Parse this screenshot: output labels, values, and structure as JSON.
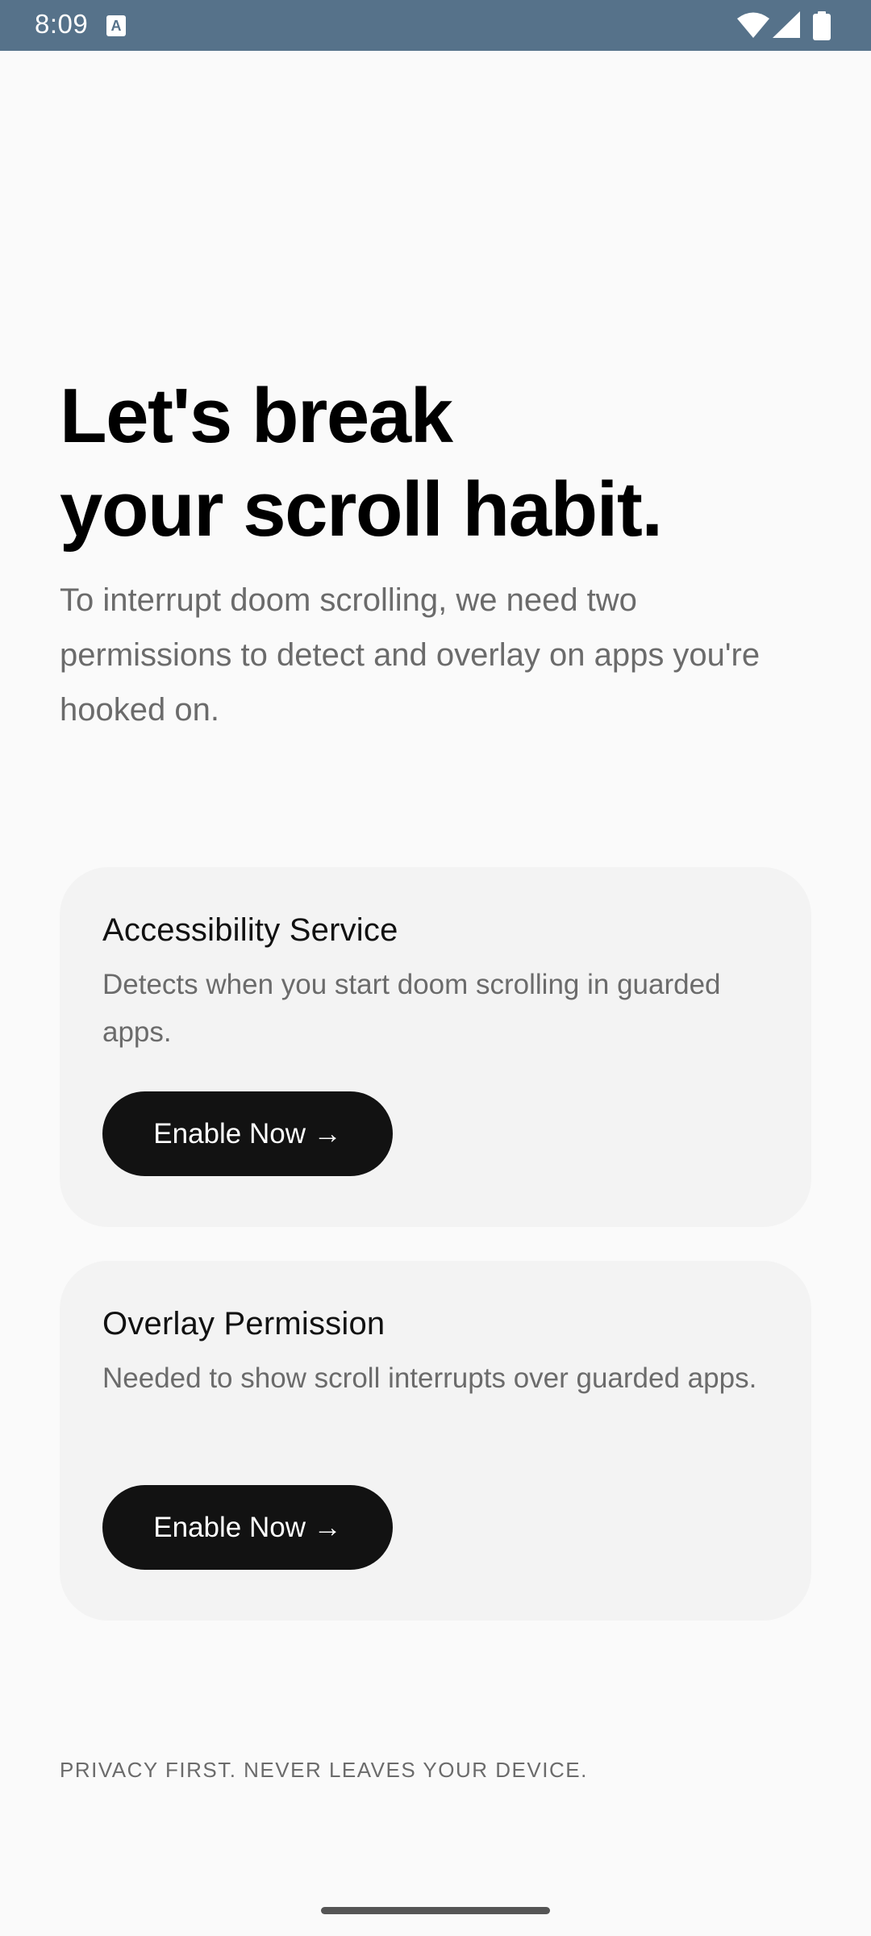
{
  "status_bar": {
    "time": "8:09",
    "notification_letter": "A",
    "icons": [
      "wifi-icon",
      "cellular-signal-icon",
      "battery-icon"
    ],
    "background_color": "#56728a"
  },
  "onboarding": {
    "headline_line1": "Let's break",
    "headline_line2": "your scroll habit.",
    "subtitle": "To interrupt doom scrolling, we need two permissions to detect and overlay on apps you're hooked on."
  },
  "permissions": [
    {
      "title": "Accessibility Service",
      "description": "Detects when you start doom scrolling in guarded apps.",
      "button_label": "Enable Now →"
    },
    {
      "title": "Overlay Permission",
      "description": "Needed to show scroll interrupts over guarded apps.",
      "button_label": "Enable Now →"
    }
  ],
  "footer": {
    "note": "PRIVACY FIRST. NEVER LEAVES YOUR DEVICE."
  },
  "colors": {
    "background": "#fafafa",
    "card": "#f3f3f3",
    "button": "#121212",
    "secondary_text": "#6b6b6b"
  }
}
